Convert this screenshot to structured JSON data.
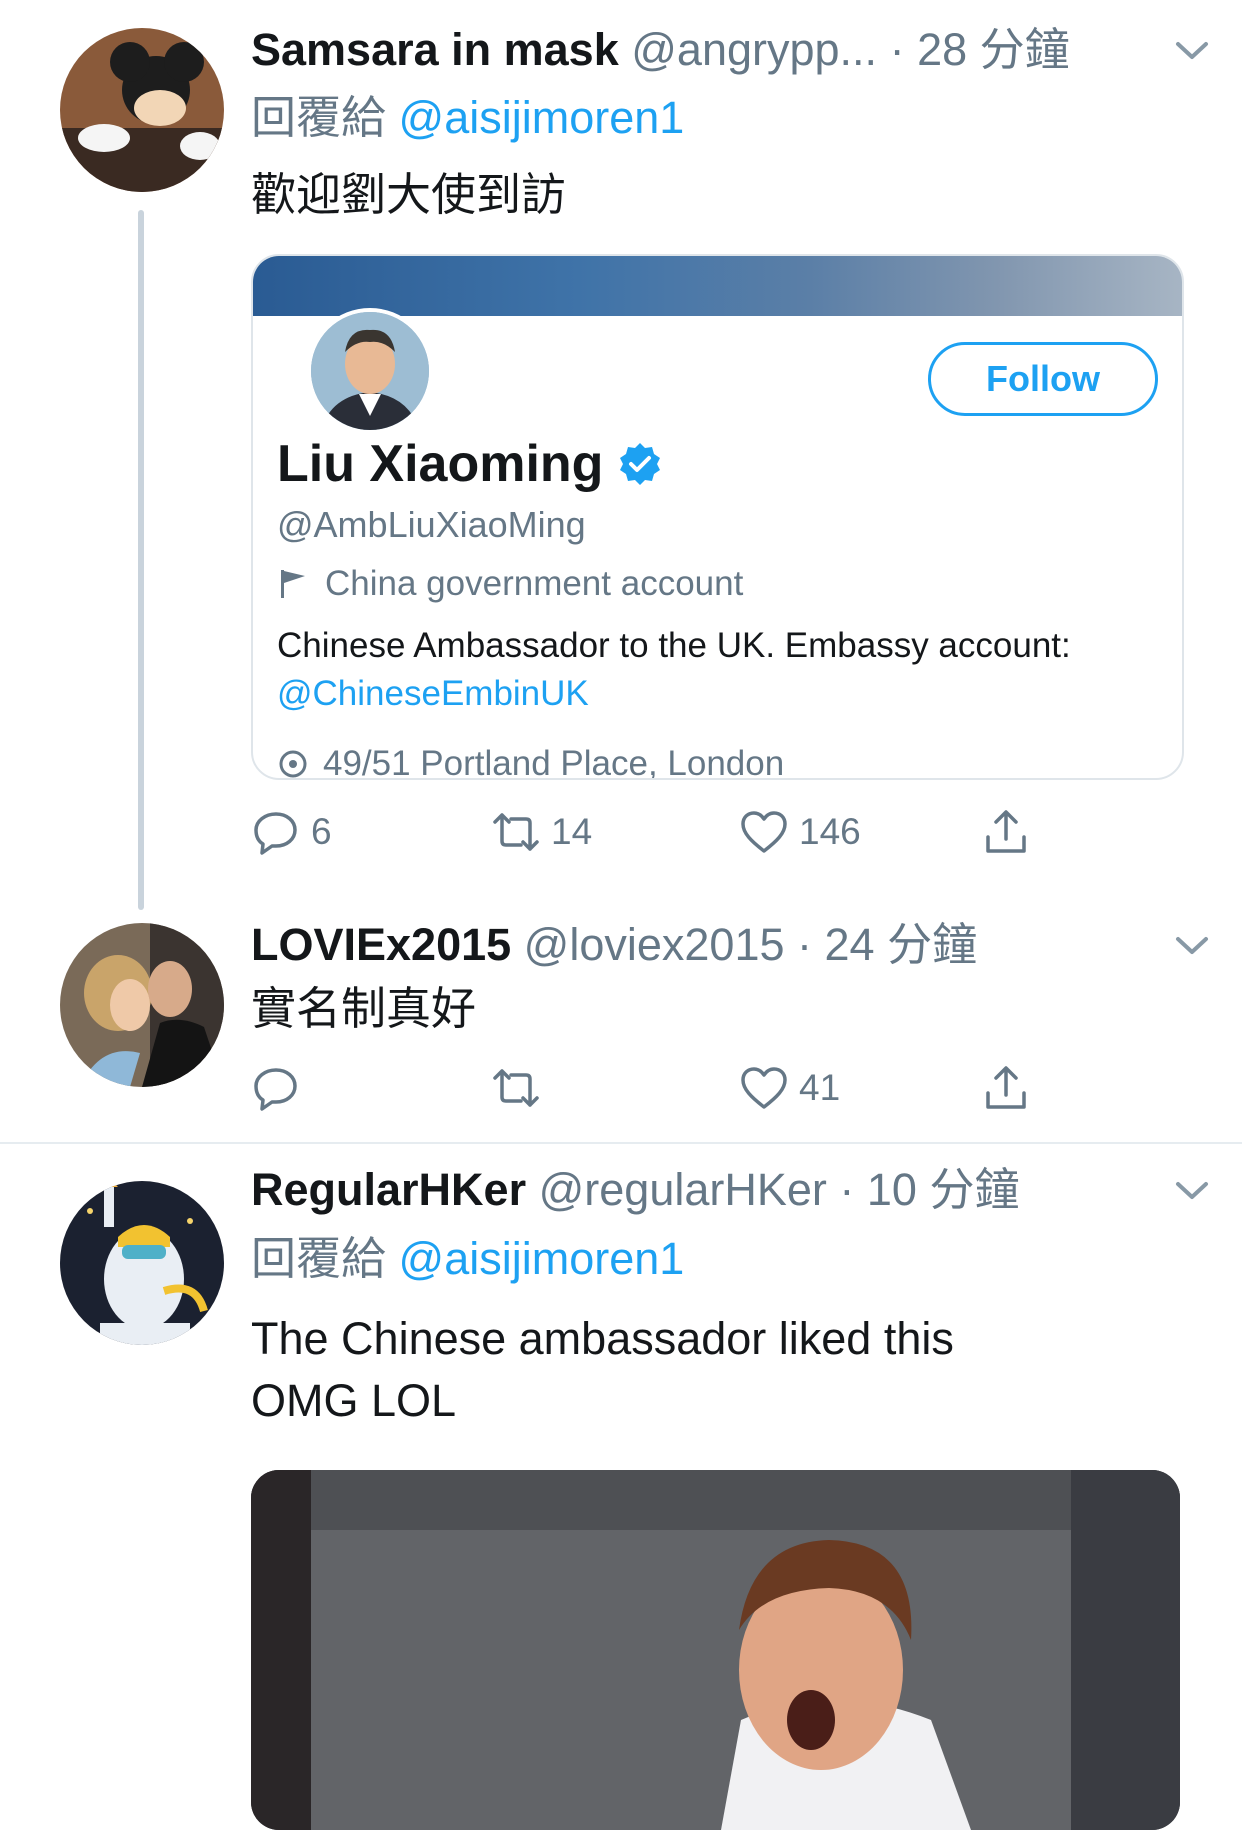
{
  "tweets": [
    {
      "name": "Samsara in mask",
      "handle": "@angrypp...",
      "dot": " · ",
      "time": "28 分鐘",
      "reply_prefix": "回覆給 ",
      "reply_to": "@aisijimoren1",
      "text": "歡迎劉大使到訪",
      "card": {
        "follow_label": "Follow",
        "name": "Liu Xiaoming",
        "handle": "@AmbLiuXiaoMing",
        "label": "China government account",
        "bio": "Chinese Ambassador to the UK.  Embassy account: ",
        "bio_mention": "@ChineseEmbinUK",
        "location": "49/51 Portland Place, London"
      },
      "replies": "6",
      "retweets": "14",
      "likes": "146"
    },
    {
      "name": "LOVIEx2015",
      "handle": "@loviex2015",
      "dot": " · ",
      "time": "24 分鐘",
      "text": "實名制真好",
      "replies": "",
      "retweets": "",
      "likes": "41"
    },
    {
      "name": "RegularHKer",
      "handle": "@regularHKer",
      "dot": " · ",
      "time": "10 分鐘",
      "reply_prefix": "回覆給 ",
      "reply_to": "@aisijimoren1",
      "text": "The Chinese ambassador liked this OMG LOL"
    }
  ],
  "colors": {
    "link": "#1da1f2",
    "secondary_text": "#657786",
    "primary_text": "#14171a",
    "verified": "#1da1f2"
  },
  "icons": [
    "reply-icon",
    "retweet-icon",
    "like-icon",
    "share-icon",
    "chevron-down-icon",
    "verified-badge-icon",
    "flag-icon",
    "location-icon"
  ]
}
